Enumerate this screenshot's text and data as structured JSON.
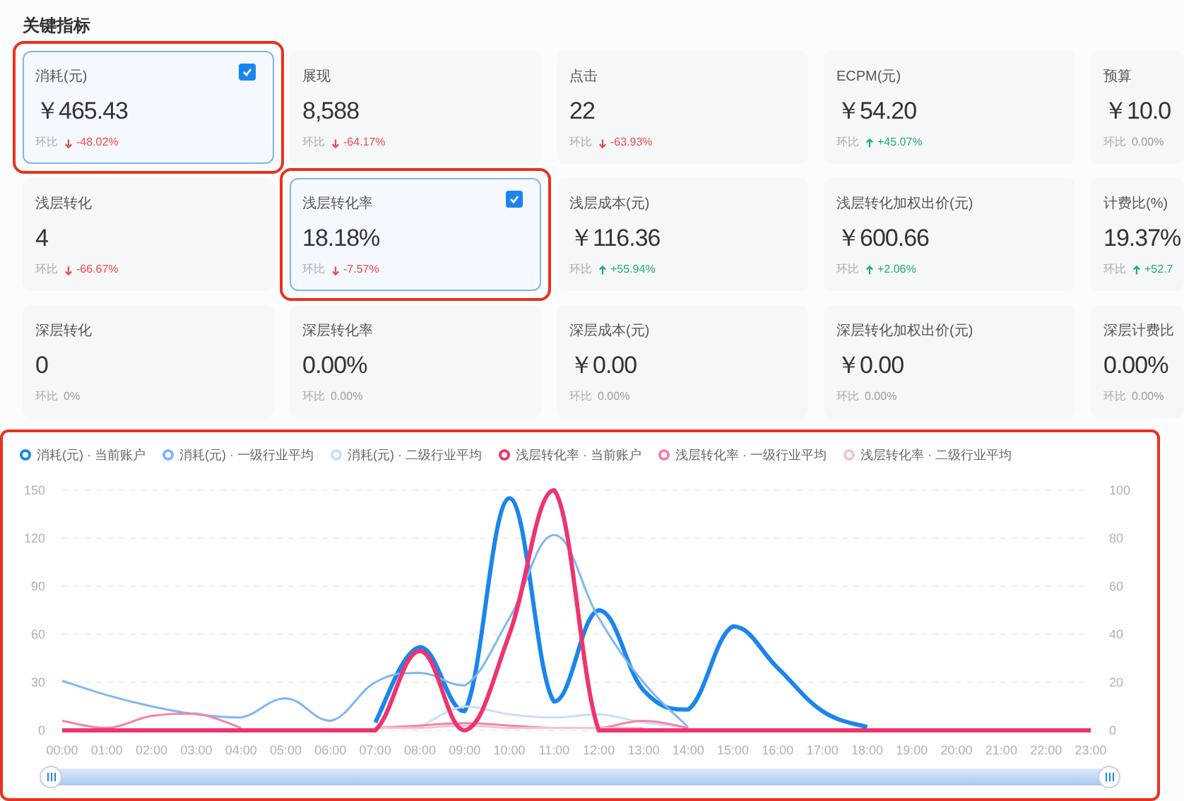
{
  "title": "关键指标",
  "cards": [
    {
      "label": "消耗(元)",
      "value": "￥465.43",
      "compare_label": "环比",
      "change": "-48.02%",
      "kind": "down",
      "selected": true,
      "annotated": true
    },
    {
      "label": "展现",
      "value": "8,588",
      "compare_label": "环比",
      "change": "-64.17%",
      "kind": "down",
      "selected": false,
      "annotated": false
    },
    {
      "label": "点击",
      "value": "22",
      "compare_label": "环比",
      "change": "-63.93%",
      "kind": "down",
      "selected": false,
      "annotated": false
    },
    {
      "label": "ECPM(元)",
      "value": "￥54.20",
      "compare_label": "环比",
      "change": "+45.07%",
      "kind": "up",
      "selected": false,
      "annotated": false
    },
    {
      "label": "预算",
      "value": "￥10.0",
      "compare_label": "环比",
      "change": "0.00%",
      "kind": "flat",
      "selected": false,
      "annotated": false
    },
    {
      "label": "浅层转化",
      "value": "4",
      "compare_label": "环比",
      "change": "-66.67%",
      "kind": "down",
      "selected": false,
      "annotated": false
    },
    {
      "label": "浅层转化率",
      "value": "18.18%",
      "compare_label": "环比",
      "change": "-7.57%",
      "kind": "down",
      "selected": true,
      "annotated": true
    },
    {
      "label": "浅层成本(元)",
      "value": "￥116.36",
      "compare_label": "环比",
      "change": "+55.94%",
      "kind": "up",
      "selected": false,
      "annotated": false
    },
    {
      "label": "浅层转化加权出价(元)",
      "value": "￥600.66",
      "compare_label": "环比",
      "change": "+2.06%",
      "kind": "up",
      "selected": false,
      "annotated": false
    },
    {
      "label": "计费比(%)",
      "value": "19.37%",
      "compare_label": "环比",
      "change": "+52.7",
      "kind": "up",
      "selected": false,
      "annotated": false
    },
    {
      "label": "深层转化",
      "value": "0",
      "compare_label": "环比",
      "change": "0%",
      "kind": "flat",
      "selected": false,
      "annotated": false
    },
    {
      "label": "深层转化率",
      "value": "0.00%",
      "compare_label": "环比",
      "change": "0.00%",
      "kind": "flat",
      "selected": false,
      "annotated": false
    },
    {
      "label": "深层成本(元)",
      "value": "￥0.00",
      "compare_label": "环比",
      "change": "0.00%",
      "kind": "flat",
      "selected": false,
      "annotated": false
    },
    {
      "label": "深层转化加权出价(元)",
      "value": "￥0.00",
      "compare_label": "环比",
      "change": "0.00%",
      "kind": "flat",
      "selected": false,
      "annotated": false
    },
    {
      "label": "深层计费比",
      "value": "0.00%",
      "compare_label": "环比",
      "change": "0.00%",
      "kind": "flat",
      "selected": false,
      "annotated": false
    }
  ],
  "chart_panel": {
    "annotated": true,
    "chart_data": {
      "type": "line",
      "grid": true,
      "x": [
        "00:00",
        "01:00",
        "02:00",
        "03:00",
        "04:00",
        "05:00",
        "06:00",
        "07:00",
        "08:00",
        "09:00",
        "10:00",
        "11:00",
        "12:00",
        "13:00",
        "14:00",
        "15:00",
        "16:00",
        "17:00",
        "18:00",
        "19:00",
        "20:00",
        "21:00",
        "22:00",
        "23:00"
      ],
      "yticks": [
        0,
        30,
        60,
        90,
        120,
        150
      ],
      "ylim": [
        0,
        150
      ],
      "y2ticks": [
        0,
        20,
        40,
        60,
        80,
        100
      ],
      "y2lim": [
        0,
        100
      ],
      "series": [
        {
          "name": "消耗(元) · 当前账户",
          "color": "#1a85ee",
          "values": [
            null,
            null,
            null,
            null,
            null,
            null,
            null,
            5,
            52,
            12,
            145,
            18,
            75,
            25,
            13,
            65,
            39,
            12,
            2,
            null,
            null,
            null,
            null,
            null
          ]
        },
        {
          "name": "消耗(元) · 一级行业平均",
          "color": "#7db7f5",
          "values": [
            31,
            22,
            15,
            10,
            8,
            20,
            6,
            30,
            36,
            28,
            70,
            122,
            70,
            30,
            2,
            null,
            null,
            null,
            null,
            null,
            null,
            null,
            null,
            null
          ]
        },
        {
          "name": "消耗(元) · 二级行业平均",
          "color": "#c9def8",
          "values": [
            null,
            null,
            null,
            null,
            null,
            null,
            null,
            null,
            2,
            15,
            10,
            8,
            10,
            5,
            2,
            null,
            null,
            null,
            null,
            null,
            null,
            null,
            null,
            null
          ]
        },
        {
          "name": "浅层转化率 · 当前账户",
          "color": "#f0336f",
          "axis": "y2",
          "values": [
            0,
            0,
            0,
            0,
            0,
            0,
            0,
            0,
            33,
            0,
            40,
            100,
            0,
            0,
            0,
            0,
            0,
            0,
            0,
            0,
            0,
            0,
            0,
            0
          ]
        },
        {
          "name": "浅层转化率 · 一级行业平均",
          "color": "#f582a7",
          "axis": "y2",
          "values": [
            4,
            1,
            6,
            7,
            1,
            null,
            null,
            1,
            2,
            3,
            2,
            1,
            1,
            4,
            1,
            null,
            null,
            null,
            null,
            null,
            null,
            null,
            null,
            null
          ]
        },
        {
          "name": "浅层转化率 · 二级行业平均",
          "color": "#f9bfd2",
          "axis": "y2",
          "values": [
            null,
            null,
            null,
            null,
            null,
            null,
            null,
            1,
            1,
            2,
            1,
            1,
            1,
            1,
            null,
            null,
            null,
            null,
            null,
            null,
            null,
            null,
            null,
            null
          ]
        }
      ]
    }
  }
}
